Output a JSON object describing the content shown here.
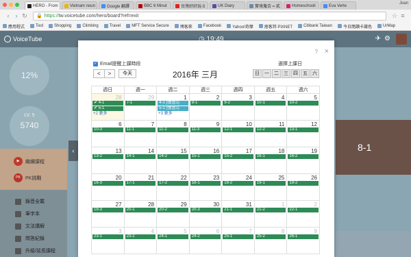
{
  "browser": {
    "tabs": [
      {
        "label": "HERO - From",
        "color": "#222222",
        "active": true
      },
      {
        "label": "Vietnam noun",
        "color": "#f0b400"
      },
      {
        "label": "Google 翻譯",
        "color": "#4a8af4"
      },
      {
        "label": "BBC 6 Minut",
        "color": "#b80000"
      },
      {
        "label": "台灣好好玩-5",
        "color": "#e62117"
      },
      {
        "label": "UK Diary",
        "color": "#5c4aa8"
      },
      {
        "label": "實境蒐合 = 貳",
        "color": "#6d8aa8"
      },
      {
        "label": "Homeschooli",
        "color": "#d6246e"
      },
      {
        "label": "Eva Verte",
        "color": "#4a8af4"
      }
    ],
    "profile": "Joan",
    "url_https": "https://",
    "url_rest": "tw.voicetube.com/hero/board?ref=exit",
    "bookmarks": [
      "應用程式",
      "Tool",
      "Shopping",
      "Climbing",
      "Travel",
      "MFT Service Secure",
      "博客來",
      "Facebook",
      "Yahoo!奇摩",
      "痞客邦 PIXNET",
      "Citibank Taiwan",
      "今日閱讀卡識色",
      "UrMap"
    ]
  },
  "site": {
    "logo": "VoiceTube",
    "clock": "19:49",
    "stat1": "12%",
    "stat2_label": "LV. 5",
    "stat2_value": "5740",
    "link1": "繼續課程",
    "link2_icon": "PK",
    "link2": "PK挑戰",
    "menu": [
      "錄音全載",
      "筆字本",
      "文法講解",
      "問答紀錄",
      "升級/延長課程"
    ],
    "hero_tag": "8-1"
  },
  "modal": {
    "email_label": "Email提醒上課時段",
    "select_days_label": "選擇上課日",
    "prev": "<",
    "next": ">",
    "today": "今天",
    "title": "2016年 三月",
    "weekday_buttons": [
      "日",
      "一",
      "二",
      "三",
      "四",
      "五",
      "六"
    ],
    "headers": [
      "週日",
      "週一",
      "週二",
      "週三",
      "週四",
      "週五",
      "週六"
    ],
    "weeks": [
      [
        {
          "d": "28",
          "other": true,
          "today": true,
          "events": [
            {
              "t": "✔ 4-1",
              "c": "g"
            },
            {
              "t": "✔ 5-1",
              "c": "g"
            }
          ],
          "more": "+2 更多"
        },
        {
          "d": "29",
          "other": true,
          "events": [
            {
              "t": "7-1",
              "c": "g"
            }
          ]
        },
        {
          "d": "1",
          "events": [
            {
              "t": "4-1 (復習1)",
              "c": "b"
            },
            {
              "t": "5-1 (復習1)",
              "c": "b"
            }
          ],
          "more": "+3 更多"
        },
        {
          "d": "2",
          "events": [
            {
              "t": "9-1",
              "c": "g"
            }
          ]
        },
        {
          "d": "3",
          "events": [
            {
              "t": "9-2",
              "c": "g"
            }
          ]
        },
        {
          "d": "4",
          "events": [
            {
              "t": "10-1",
              "c": "g"
            }
          ]
        },
        {
          "d": "5",
          "events": [
            {
              "t": "10-2",
              "c": "g"
            }
          ]
        }
      ],
      [
        {
          "d": "6",
          "events": [
            {
              "t": "10-3",
              "c": "g"
            }
          ]
        },
        {
          "d": "7",
          "events": [
            {
              "t": "11-1",
              "c": "g"
            }
          ]
        },
        {
          "d": "8",
          "events": [
            {
              "t": "11-2",
              "c": "g"
            }
          ]
        },
        {
          "d": "9",
          "events": [
            {
              "t": "11-3",
              "c": "g"
            }
          ]
        },
        {
          "d": "10",
          "events": [
            {
              "t": "12-1",
              "c": "g"
            }
          ]
        },
        {
          "d": "11",
          "events": [
            {
              "t": "12-2",
              "c": "g"
            }
          ]
        },
        {
          "d": "12",
          "events": [
            {
              "t": "13-1",
              "c": "g"
            }
          ]
        }
      ],
      [
        {
          "d": "13",
          "events": [
            {
              "t": "13-2",
              "c": "g"
            }
          ]
        },
        {
          "d": "14",
          "events": [
            {
              "t": "14-1",
              "c": "g"
            }
          ]
        },
        {
          "d": "15",
          "events": [
            {
              "t": "14-2",
              "c": "g"
            }
          ]
        },
        {
          "d": "16",
          "events": [
            {
              "t": "15-1",
              "c": "g"
            }
          ]
        },
        {
          "d": "17",
          "events": [
            {
              "t": "15-2",
              "c": "g"
            }
          ]
        },
        {
          "d": "18",
          "events": [
            {
              "t": "16-1",
              "c": "g"
            }
          ]
        },
        {
          "d": "19",
          "events": [
            {
              "t": "16-2",
              "c": "g"
            }
          ]
        }
      ],
      [
        {
          "d": "20",
          "events": [
            {
              "t": "16-3",
              "c": "g"
            }
          ]
        },
        {
          "d": "21",
          "events": [
            {
              "t": "17-1",
              "c": "g"
            }
          ]
        },
        {
          "d": "22",
          "events": [
            {
              "t": "17-2",
              "c": "g"
            }
          ]
        },
        {
          "d": "23",
          "events": [
            {
              "t": "18-1",
              "c": "g"
            }
          ]
        },
        {
          "d": "24",
          "events": [
            {
              "t": "18-2",
              "c": "g"
            }
          ]
        },
        {
          "d": "25",
          "events": [
            {
              "t": "19-1",
              "c": "g"
            }
          ]
        },
        {
          "d": "26",
          "events": [
            {
              "t": "19-2",
              "c": "g"
            }
          ]
        }
      ],
      [
        {
          "d": "27",
          "events": [
            {
              "t": "19-3",
              "c": "g"
            }
          ]
        },
        {
          "d": "28",
          "events": [
            {
              "t": "20-1",
              "c": "g"
            }
          ]
        },
        {
          "d": "29",
          "events": [
            {
              "t": "20-2",
              "c": "g"
            }
          ]
        },
        {
          "d": "30",
          "events": [
            {
              "t": "20-3",
              "c": "g"
            }
          ]
        },
        {
          "d": "31",
          "events": [
            {
              "t": "21-1",
              "c": "g"
            }
          ]
        },
        {
          "d": "1",
          "other": true,
          "events": [
            {
              "t": "21-2",
              "c": "g"
            }
          ]
        },
        {
          "d": "2",
          "other": true,
          "events": [
            {
              "t": "22-1",
              "c": "g"
            }
          ]
        }
      ],
      [
        {
          "d": "3",
          "other": true,
          "events": [
            {
              "t": "23-1",
              "c": "g"
            }
          ]
        },
        {
          "d": "4",
          "other": true,
          "events": [
            {
              "t": "23-2",
              "c": "g"
            }
          ]
        },
        {
          "d": "5",
          "other": true,
          "events": [
            {
              "t": "24-1",
              "c": "g"
            }
          ]
        },
        {
          "d": "6",
          "other": true,
          "events": [
            {
              "t": "24-2",
              "c": "g"
            }
          ]
        },
        {
          "d": "7",
          "other": true,
          "events": [
            {
              "t": "25-1",
              "c": "g"
            }
          ]
        },
        {
          "d": "8",
          "other": true,
          "events": [
            {
              "t": "25-2",
              "c": "g"
            }
          ]
        },
        {
          "d": "9",
          "other": true,
          "events": [
            {
              "t": "26-1",
              "c": "g"
            }
          ]
        }
      ]
    ]
  },
  "colors": {
    "event_green": "#2e8b57",
    "event_blue": "#4aaec5",
    "today_bg": "#fcf8e3"
  }
}
